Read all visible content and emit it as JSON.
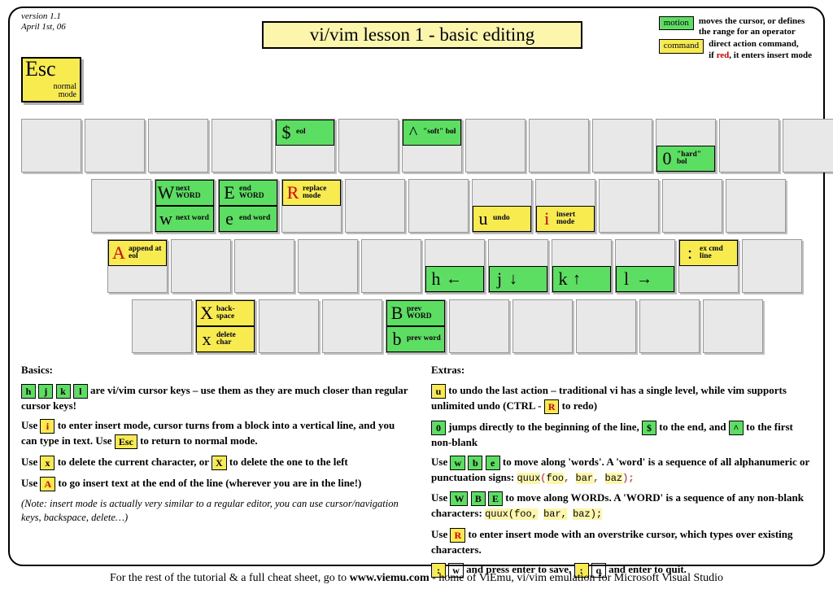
{
  "version": "version 1.1",
  "date": "April 1st, 06",
  "title": "vi/vim lesson 1 - basic editing",
  "legend": {
    "motion": {
      "label": "motion",
      "desc1": "moves the cursor, or defines",
      "desc2": "the range for an operator"
    },
    "command": {
      "label": "command",
      "desc1": "direct action command,",
      "desc2a": "if ",
      "desc2b": "red",
      "desc2c": ", it enters insert mode"
    }
  },
  "esc": {
    "big": "Esc",
    "sm1": "normal",
    "sm2": "mode"
  },
  "keys": {
    "dollar": {
      "g": "$",
      "d": "eol"
    },
    "caret": {
      "g": "^",
      "d": "\"soft\" bol"
    },
    "zero": {
      "g": "0",
      "d": "\"hard\" bol"
    },
    "W": {
      "g": "W",
      "d": "next WORD"
    },
    "E": {
      "g": "E",
      "d": "end WORD"
    },
    "R": {
      "g": "R",
      "d": "replace mode"
    },
    "w": {
      "g": "w",
      "d": "next word"
    },
    "e": {
      "g": "e",
      "d": "end word"
    },
    "u": {
      "g": "u",
      "d": "undo"
    },
    "i": {
      "g": "i",
      "d": "insert mode"
    },
    "A": {
      "g": "A",
      "d": "append at eol"
    },
    "colon": {
      "g": ":",
      "d": "ex cmd line"
    },
    "h": {
      "g": "h",
      "a": "←"
    },
    "j": {
      "g": "j",
      "a": "↓"
    },
    "k": {
      "g": "k",
      "a": "↑"
    },
    "l": {
      "g": "l",
      "a": "→"
    },
    "X": {
      "g": "X",
      "d": "back-space"
    },
    "x": {
      "g": "x",
      "d": "delete char"
    },
    "B": {
      "g": "B",
      "d": "prev WORD"
    },
    "b": {
      "g": "b",
      "d": "prev word"
    }
  },
  "basics": {
    "heading": "Basics:",
    "p1a": " are vi/vim cursor keys – use them as they are  much closer than regular cursor keys!",
    "p2a": "Use ",
    "p2b": " to enter insert mode, cursor turns from a block into a vertical line, and you can type in text. Use ",
    "p2c": " to  return to normal mode.",
    "p3a": "Use ",
    "p3b": " to delete the current character, or ",
    "p3c": " to delete the one to the left",
    "p4a": "Use ",
    "p4b": " to go insert text at the end of the line (wherever you are in the line!)",
    "note": "(Note: insert mode is actually very similar to a regular editor, you can use cursor/navigation keys, backspace,  delete…)"
  },
  "extras": {
    "heading": "Extras:",
    "p1a": " to undo the last action – traditional vi has a single level, while vim supports unlimited undo (CTRL - ",
    "p1b": " to redo)",
    "p2a": " jumps directly to the beginning of the line, ",
    "p2b": " to the end, and ",
    "p2c": " to the first non-blank",
    "p3a": "Use ",
    "p3b": " to move along 'words'. A 'word' is a sequence of all alphanumeric or punctuation signs:   ",
    "p3code": "quux(foo, bar, baz);",
    "p4a": "Use ",
    "p4b": " to move along WORDs. A 'WORD' is a sequence of any non-blank characters:   ",
    "p4code": "quux(foo, bar, baz);",
    "p5a": "Use ",
    "p5b": " to enter insert mode with an overstrike cursor, which types over existing characters.",
    "p6a": " and press enter to save, ",
    "p6b": " and enter to quit."
  },
  "labels": {
    "h": "h",
    "j": "j",
    "k": "k",
    "l": "l",
    "i": "i",
    "Esc": "Esc",
    "x": "x",
    "X": "X",
    "A": "A",
    "u": "u",
    "R": "R",
    "zero": "0",
    "dollar": "$",
    "caret": "^",
    "w": "w",
    "b": "b",
    "e": "e",
    "W": "W",
    "B": "B",
    "E": "E",
    "colon": ":",
    "q": "q"
  },
  "footer": {
    "a": "For the rest of the tutorial & a full cheat sheet, go to ",
    "url1": "www.viemu.com",
    "b": " - home of ViEmu, vi/vim emulation for Microsoft Visual Studio"
  }
}
